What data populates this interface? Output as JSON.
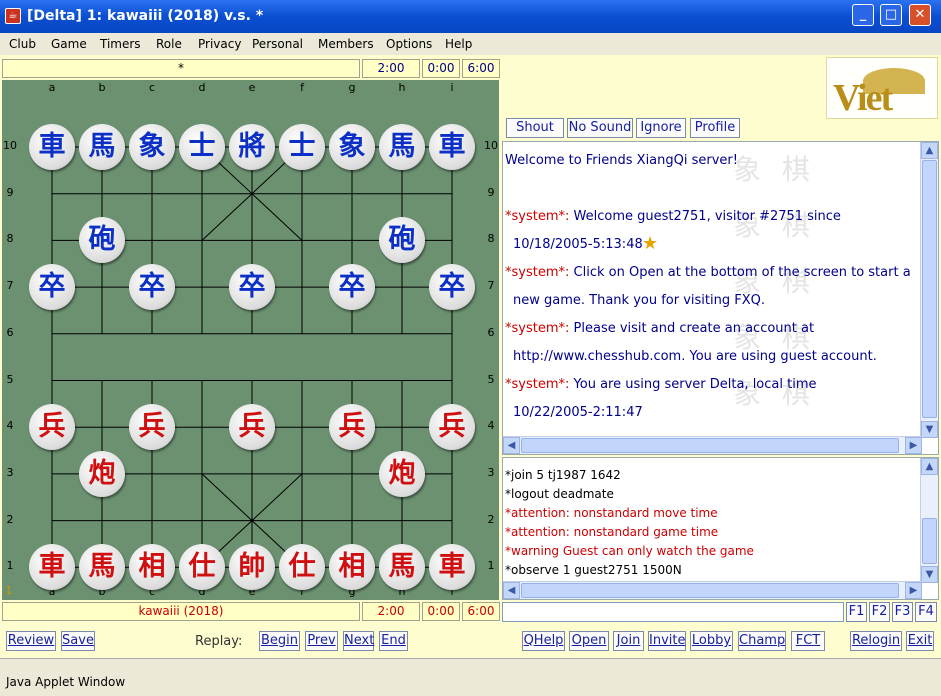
{
  "window": {
    "title": "[Delta] 1: kawaiii (2018) v.s. *",
    "app_icon": "java-icon"
  },
  "menu": [
    "Club",
    "Game",
    "Timers",
    "Role",
    "Privacy",
    "Personal",
    "Members",
    "Options",
    "Help"
  ],
  "top_player": {
    "name": "*",
    "time_control": "2:00",
    "clock": "0:00",
    "game_time": "6:00"
  },
  "bottom_player": {
    "name": "kawaiii (2018)",
    "time_control": "2:00",
    "clock": "0:00",
    "game_time": "6:00"
  },
  "board": {
    "files": [
      "a",
      "b",
      "c",
      "d",
      "e",
      "f",
      "g",
      "h",
      "i"
    ],
    "ranks": [
      "10",
      "9",
      "8",
      "7",
      "6",
      "5",
      "4",
      "3",
      "2",
      "1"
    ],
    "move_number": "1",
    "pieces": [
      {
        "char": "車",
        "side": "blue",
        "file": 0,
        "rank": 10
      },
      {
        "char": "馬",
        "side": "blue",
        "file": 1,
        "rank": 10
      },
      {
        "char": "象",
        "side": "blue",
        "file": 2,
        "rank": 10
      },
      {
        "char": "士",
        "side": "blue",
        "file": 3,
        "rank": 10
      },
      {
        "char": "將",
        "side": "blue",
        "file": 4,
        "rank": 10
      },
      {
        "char": "士",
        "side": "blue",
        "file": 5,
        "rank": 10
      },
      {
        "char": "象",
        "side": "blue",
        "file": 6,
        "rank": 10
      },
      {
        "char": "馬",
        "side": "blue",
        "file": 7,
        "rank": 10
      },
      {
        "char": "車",
        "side": "blue",
        "file": 8,
        "rank": 10
      },
      {
        "char": "砲",
        "side": "blue",
        "file": 1,
        "rank": 8
      },
      {
        "char": "砲",
        "side": "blue",
        "file": 7,
        "rank": 8
      },
      {
        "char": "卒",
        "side": "blue",
        "file": 0,
        "rank": 7
      },
      {
        "char": "卒",
        "side": "blue",
        "file": 2,
        "rank": 7
      },
      {
        "char": "卒",
        "side": "blue",
        "file": 4,
        "rank": 7
      },
      {
        "char": "卒",
        "side": "blue",
        "file": 6,
        "rank": 7
      },
      {
        "char": "卒",
        "side": "blue",
        "file": 8,
        "rank": 7
      },
      {
        "char": "兵",
        "side": "red",
        "file": 0,
        "rank": 4
      },
      {
        "char": "兵",
        "side": "red",
        "file": 2,
        "rank": 4
      },
      {
        "char": "兵",
        "side": "red",
        "file": 4,
        "rank": 4
      },
      {
        "char": "兵",
        "side": "red",
        "file": 6,
        "rank": 4
      },
      {
        "char": "兵",
        "side": "red",
        "file": 8,
        "rank": 4
      },
      {
        "char": "炮",
        "side": "red",
        "file": 1,
        "rank": 3
      },
      {
        "char": "炮",
        "side": "red",
        "file": 7,
        "rank": 3
      },
      {
        "char": "車",
        "side": "red",
        "file": 0,
        "rank": 1
      },
      {
        "char": "馬",
        "side": "red",
        "file": 1,
        "rank": 1
      },
      {
        "char": "相",
        "side": "red",
        "file": 2,
        "rank": 1
      },
      {
        "char": "仕",
        "side": "red",
        "file": 3,
        "rank": 1
      },
      {
        "char": "帥",
        "side": "red",
        "file": 4,
        "rank": 1
      },
      {
        "char": "仕",
        "side": "red",
        "file": 5,
        "rank": 1
      },
      {
        "char": "相",
        "side": "red",
        "file": 6,
        "rank": 1
      },
      {
        "char": "馬",
        "side": "red",
        "file": 7,
        "rank": 1
      },
      {
        "char": "車",
        "side": "red",
        "file": 8,
        "rank": 1
      }
    ]
  },
  "logo": {
    "text": "Viet"
  },
  "chat_buttons": [
    "Shout",
    "No Sound",
    "Ignore",
    "Profile"
  ],
  "chat_watermark": [
    "象 棋",
    "象 棋",
    "象 棋",
    "象 棋",
    "象 棋"
  ],
  "chat": {
    "l1": "Welcome to Friends XiangQi server!",
    "l2_sys": "*system*:",
    "l2": " Welcome guest2751, visitor #2751 since",
    "l3": "10/18/2005-5:13:48",
    "l4_sys": "*system*:",
    "l4": " Click on Open at the bottom of the screen to start a",
    "l5": "new game. Thank you for visiting FXQ.",
    "l6_sys": "*system*:",
    "l6": " Please visit and create an account at",
    "l7": "http://www.chesshub.com. You are using guest account.",
    "l8_sys": "*system*:",
    "l8": " You are using server Delta, local time",
    "l9": "10/22/2005-2:11:47"
  },
  "log": [
    {
      "text": "*join 5 tj1987 1642",
      "color": "black"
    },
    {
      "text": "*logout deadmate",
      "color": "black"
    },
    {
      "text": "*attention: nonstandard move time",
      "color": "red"
    },
    {
      "text": "*attention: nonstandard game time",
      "color": "red"
    },
    {
      "text": "*warning Guest can only watch the game",
      "color": "red"
    },
    {
      "text": "*observe 1 guest2751 1500N",
      "color": "black"
    }
  ],
  "input": {
    "value": ""
  },
  "fkeys": [
    "F1",
    "F2",
    "F3",
    "F4"
  ],
  "bottom_left": {
    "review": "Review",
    "save": "Save",
    "replay_label": "Replay:",
    "begin": "Begin",
    "prev": "Prev",
    "next": "Next",
    "end": "End"
  },
  "bottom_right": [
    "QHelp",
    "Open",
    "Join",
    "Invite",
    "Lobby",
    "Champ",
    "FCT",
    "Relogin",
    "Exit"
  ],
  "status": "Java Applet Window",
  "colors": {
    "board": "#6b9171",
    "panel": "#fdfdd0",
    "blue_piece": "#0c2fc6",
    "red_piece": "#d01010",
    "system": "#cc0000",
    "chat_text": "#00008b"
  }
}
